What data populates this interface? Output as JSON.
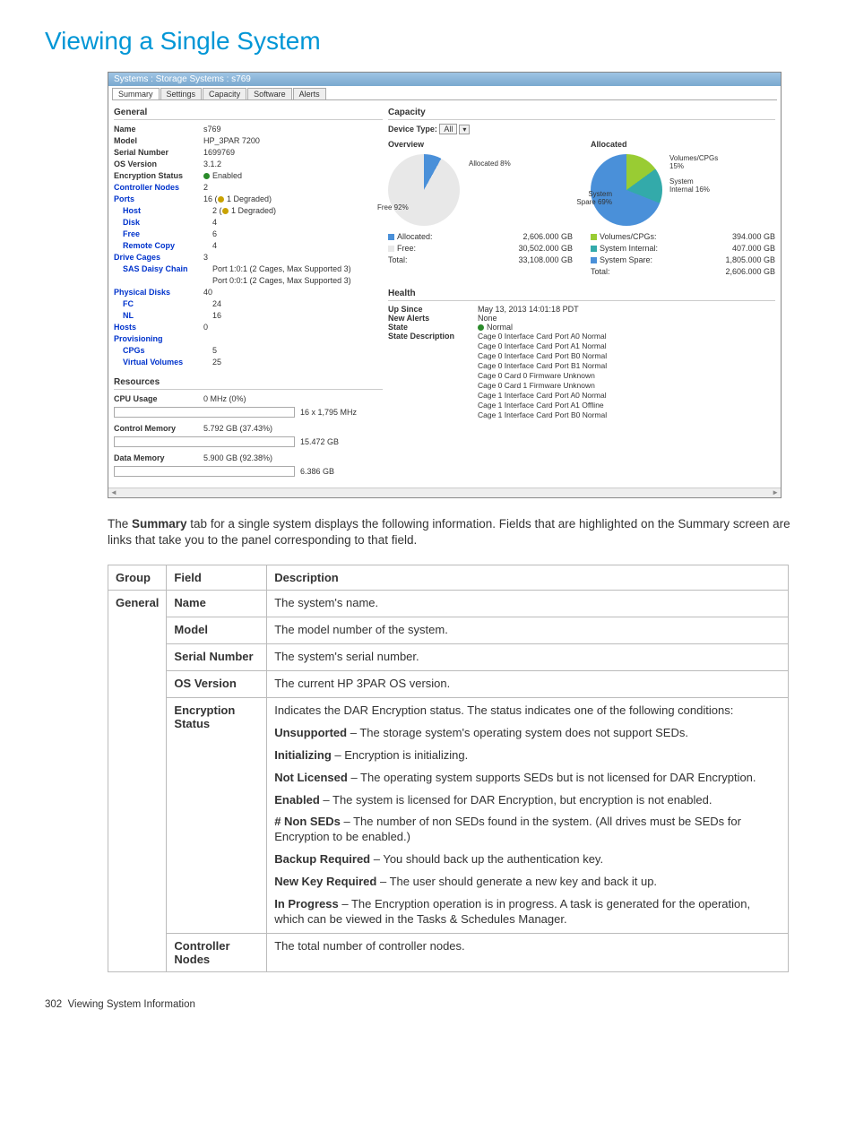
{
  "page": {
    "title": "Viewing a Single System",
    "intro_pre": "The ",
    "intro_bold": "Summary",
    "intro_post": " tab for a single system displays the following information. Fields that are highlighted on the Summary screen are links that take you to the panel corresponding to that field.",
    "footer_num": "302",
    "footer_text": "Viewing System Information"
  },
  "screenshot": {
    "titlebar": "Systems : Storage Systems : s769",
    "tabs": [
      "Summary",
      "Settings",
      "Capacity",
      "Software",
      "Alerts"
    ],
    "general": {
      "header": "General",
      "rows": [
        {
          "k": "Name",
          "v": "s769",
          "bold": true
        },
        {
          "k": "Model",
          "v": "HP_3PAR 7200",
          "bold": true
        },
        {
          "k": "Serial Number",
          "v": "1699769",
          "bold": true
        },
        {
          "k": "OS Version",
          "v": "3.1.2",
          "bold": true
        },
        {
          "k": "Encryption Status",
          "v": "Enabled",
          "bold": true,
          "dot": "g"
        },
        {
          "k": "Controller Nodes",
          "v": "2",
          "link": true
        },
        {
          "k": "Ports",
          "v": "16 (⚠ 1 Degraded)",
          "link": true,
          "warn": true
        },
        {
          "k": "Host",
          "v": "2 (⚠ 1 Degraded)",
          "link": true,
          "indent": 1,
          "warn": true
        },
        {
          "k": "Disk",
          "v": "4",
          "link": true,
          "indent": 1
        },
        {
          "k": "Free",
          "v": "6",
          "link": true,
          "indent": 1
        },
        {
          "k": "Remote Copy",
          "v": "4",
          "link": true,
          "indent": 1
        },
        {
          "k": "Drive Cages",
          "v": "3",
          "link": true
        },
        {
          "k": "SAS Daisy Chain",
          "v": "Port 1:0:1 (2 Cages, Max Supported 3)",
          "link": true,
          "indent": 1
        },
        {
          "k": "",
          "v": "Port 0:0:1 (2 Cages, Max Supported 3)",
          "indent": 1
        },
        {
          "k": "Physical Disks",
          "v": "40",
          "link": true
        },
        {
          "k": "FC",
          "v": "24",
          "link": true,
          "indent": 1
        },
        {
          "k": "NL",
          "v": "16",
          "link": true,
          "indent": 1
        },
        {
          "k": "Hosts",
          "v": "0",
          "link": true
        },
        {
          "k": "Provisioning",
          "v": "",
          "link": true
        },
        {
          "k": "CPGs",
          "v": "5",
          "link": true,
          "indent": 1
        },
        {
          "k": "Virtual Volumes",
          "v": "25",
          "link": true,
          "indent": 1
        }
      ]
    },
    "resources": {
      "header": "Resources",
      "cpu_label": "CPU Usage",
      "cpu_val": "0 MHz (0%)",
      "cpu_right": "16 x 1,795 MHz",
      "cpu_pct": 0,
      "cm_label": "Control Memory",
      "cm_val": "5.792 GB (37.43%)",
      "cm_right": "15.472 GB",
      "cm_pct": 37.43,
      "dm_label": "Data Memory",
      "dm_val": "5.900 GB (92.38%)",
      "dm_right": "6.386 GB",
      "dm_pct": 92.38
    },
    "capacity": {
      "header": "Capacity",
      "device_type_label": "Device Type:",
      "device_type_value": "All",
      "overview_label": "Overview",
      "allocated_label": "Allocated",
      "overview": {
        "pie_labels": {
          "alloc": "Allocated 8%",
          "free": "Free 92%"
        },
        "legend": [
          {
            "c": "b",
            "name": "Allocated:",
            "val": "2,606.000 GB"
          },
          {
            "c": "g",
            "name": "Free:",
            "val": "30,502.000 GB"
          },
          {
            "c": "",
            "name": "Total:",
            "val": "33,108.000 GB"
          }
        ]
      },
      "allocated": {
        "pie_labels": {
          "a": "Volumes/CPGs 15%",
          "b": "System Internal 16%",
          "c": "System Spare 69%"
        },
        "legend": [
          {
            "c": "lime",
            "name": "Volumes/CPGs:",
            "val": "394.000 GB"
          },
          {
            "c": "teal",
            "name": "System Internal:",
            "val": "407.000 GB"
          },
          {
            "c": "b",
            "name": "System Spare:",
            "val": "1,805.000 GB"
          },
          {
            "c": "",
            "name": "Total:",
            "val": "2,606.000 GB"
          }
        ]
      }
    },
    "health": {
      "header": "Health",
      "rows": [
        {
          "k": "Up Since",
          "v": "May 13, 2013 14:01:18 PDT"
        },
        {
          "k": "New Alerts",
          "v": "None"
        },
        {
          "k": "State",
          "v": "Normal",
          "dot": "g"
        },
        {
          "k": "State Description",
          "list": [
            "Cage 0 Interface Card Port A0 Normal",
            "Cage 0 Interface Card Port A1 Normal",
            "Cage 0 Interface Card Port B0 Normal",
            "Cage 0 Interface Card Port B1 Normal",
            "Cage 0 Card 0 Firmware Unknown",
            "Cage 0 Card 1 Firmware Unknown",
            "Cage 1 Interface Card Port A0 Normal",
            "Cage 1 Interface Card Port A1 Offline",
            "Cage 1 Interface Card Port B0 Normal"
          ]
        }
      ]
    }
  },
  "chart_data": [
    {
      "type": "pie",
      "title": "Capacity Overview",
      "series": [
        {
          "name": "Allocated",
          "value": 2606.0
        },
        {
          "name": "Free",
          "value": 30502.0
        }
      ],
      "total": 33108.0,
      "unit": "GB"
    },
    {
      "type": "pie",
      "title": "Capacity Allocated",
      "series": [
        {
          "name": "Volumes/CPGs",
          "value": 394.0
        },
        {
          "name": "System Internal",
          "value": 407.0
        },
        {
          "name": "System Spare",
          "value": 1805.0
        }
      ],
      "total": 2606.0,
      "unit": "GB"
    },
    {
      "type": "bar",
      "title": "CPU Usage",
      "categories": [
        "CPU"
      ],
      "values": [
        0
      ],
      "ylabel": "MHz",
      "ylim": [
        0,
        28720
      ],
      "annotation": "16 x 1,795 MHz"
    },
    {
      "type": "bar",
      "title": "Control Memory",
      "categories": [
        "Control Memory"
      ],
      "values": [
        5.792
      ],
      "ylim": [
        0,
        15.472
      ],
      "unit": "GB",
      "pct": 37.43
    },
    {
      "type": "bar",
      "title": "Data Memory",
      "categories": [
        "Data Memory"
      ],
      "values": [
        5.9
      ],
      "ylim": [
        0,
        6.386
      ],
      "unit": "GB",
      "pct": 92.38
    }
  ],
  "table": {
    "headers": [
      "Group",
      "Field",
      "Description"
    ],
    "rows": [
      {
        "group": "General",
        "field": "Name",
        "desc": [
          {
            "t": "The system's name."
          }
        ]
      },
      {
        "group": "",
        "field": "Model",
        "desc": [
          {
            "t": "The model number of the system."
          }
        ]
      },
      {
        "group": "",
        "field": "Serial Number",
        "desc": [
          {
            "t": "The system's serial number."
          }
        ]
      },
      {
        "group": "",
        "field": "OS Version",
        "desc": [
          {
            "t": "The current HP 3PAR OS version."
          }
        ]
      },
      {
        "group": "",
        "field": "Encryption Status",
        "desc": [
          {
            "t": "Indicates the DAR Encryption status. The status indicates one of the following conditions:"
          },
          {
            "b": "Unsupported",
            "t": " – The storage system's operating system does not support SEDs."
          },
          {
            "b": "Initializing",
            "t": " – Encryption is initializing."
          },
          {
            "b": "Not Licensed",
            "t": " – The operating system supports SEDs but is not licensed for DAR Encryption."
          },
          {
            "b": "Enabled",
            "t": " – The system is licensed for DAR Encryption, but encryption is not enabled."
          },
          {
            "b": "# Non SEDs",
            "t": " – The number of non SEDs found in the system. (All drives must be SEDs for Encryption to be enabled.)"
          },
          {
            "b": "Backup Required",
            "t": " – You should back up the authentication key."
          },
          {
            "b": "New Key Required",
            "t": " – The user should generate a new key and back it up."
          },
          {
            "b": "In Progress",
            "t": " – The Encryption operation is in progress. A task is generated for the operation, which can be viewed in the Tasks & Schedules Manager."
          }
        ]
      },
      {
        "group": "",
        "field": "Controller Nodes",
        "desc": [
          {
            "t": "The total number of controller nodes."
          }
        ]
      }
    ]
  }
}
